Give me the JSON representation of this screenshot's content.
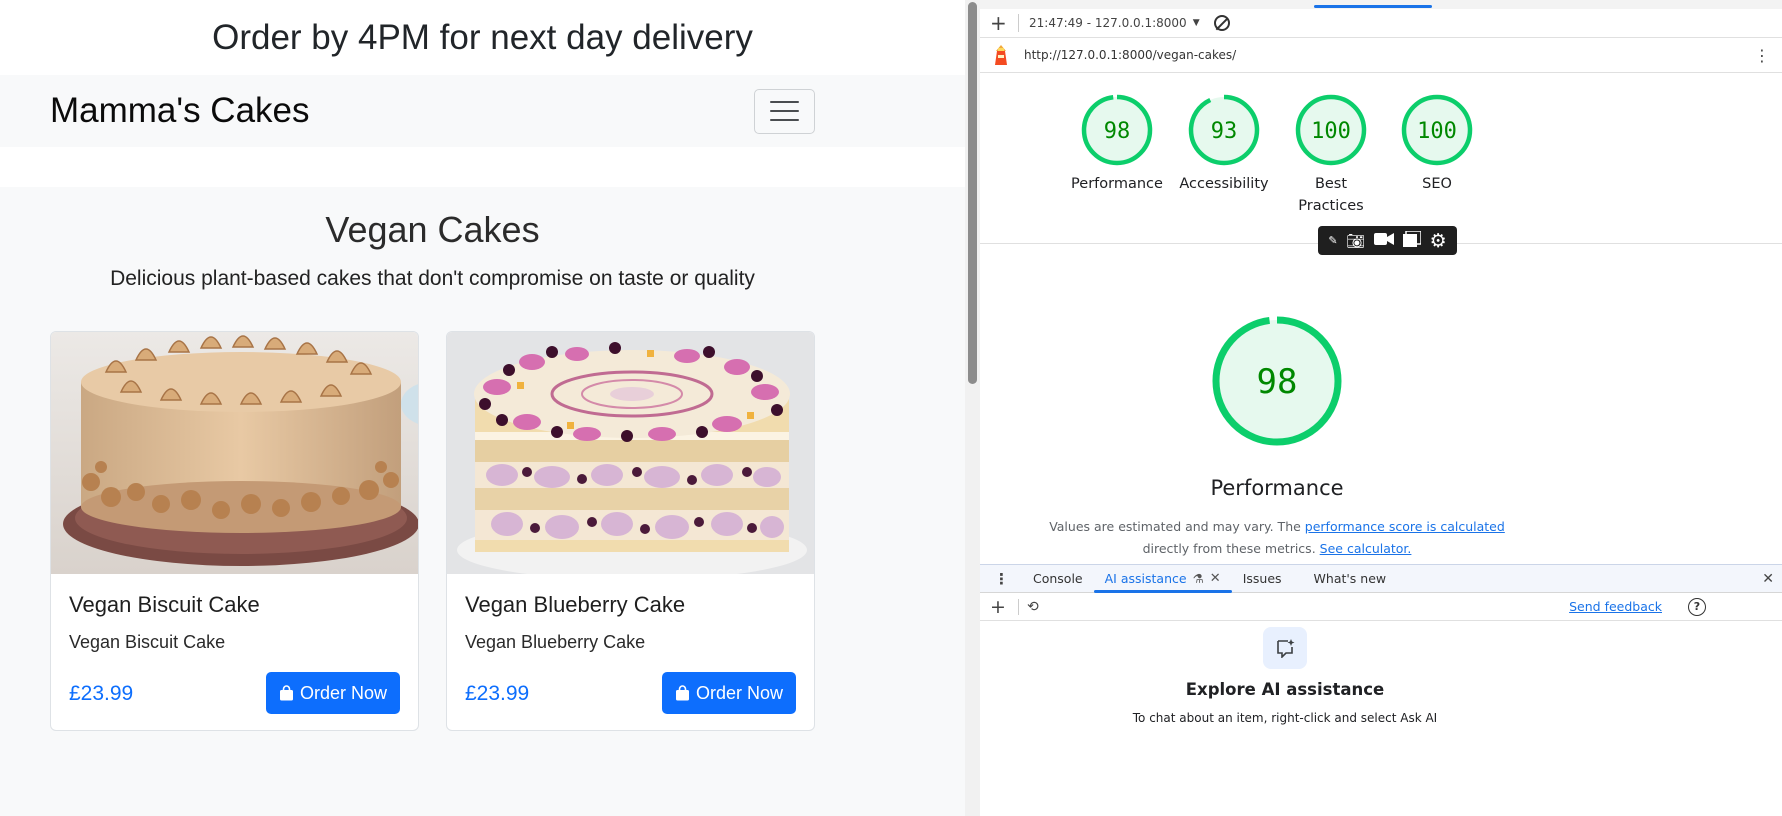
{
  "site": {
    "banner": "Order by 4PM for next day delivery",
    "brand": "Mamma's Cakes",
    "section_title": "Vegan Cakes",
    "section_lead": "Delicious plant-based cakes that don't compromise on taste or quality",
    "products": [
      {
        "name": "Vegan Biscuit Cake",
        "description": "Vegan Biscuit Cake",
        "price": "£23.99",
        "button": "Order Now"
      },
      {
        "name": "Vegan Blueberry Cake",
        "description": "Vegan Blueberry Cake",
        "price": "£23.99",
        "button": "Order Now"
      }
    ]
  },
  "devtools": {
    "report_time": "21:47:49 - 127.0.0.1:8000",
    "url": "http://127.0.0.1:8000/vegan-cakes/",
    "scores": [
      {
        "label": "Performance",
        "value": 98
      },
      {
        "label": "Accessibility",
        "value": 93
      },
      {
        "label": "Best Practices",
        "value": 100
      },
      {
        "label": "SEO",
        "value": 100
      }
    ],
    "main_score": {
      "label": "Performance",
      "value": 98
    },
    "note_prefix": "Values are estimated and may vary. The",
    "note_link1": "performance score is calculated",
    "note_middle": "directly from these metrics.",
    "note_link2": "See calculator.",
    "drawer_tabs": [
      "Console",
      "AI assistance",
      "Issues",
      "What's new"
    ],
    "send_feedback": "Send feedback",
    "ai_title": "Explore AI assistance",
    "ai_sub": "To chat about an item, right-click and select Ask AI",
    "colors": {
      "pass": "#0cce6b",
      "pass_text": "#008800",
      "pass_fill": "#e6f9ee",
      "accent": "#1a73e8",
      "brand_blue": "#0d6efd"
    }
  }
}
